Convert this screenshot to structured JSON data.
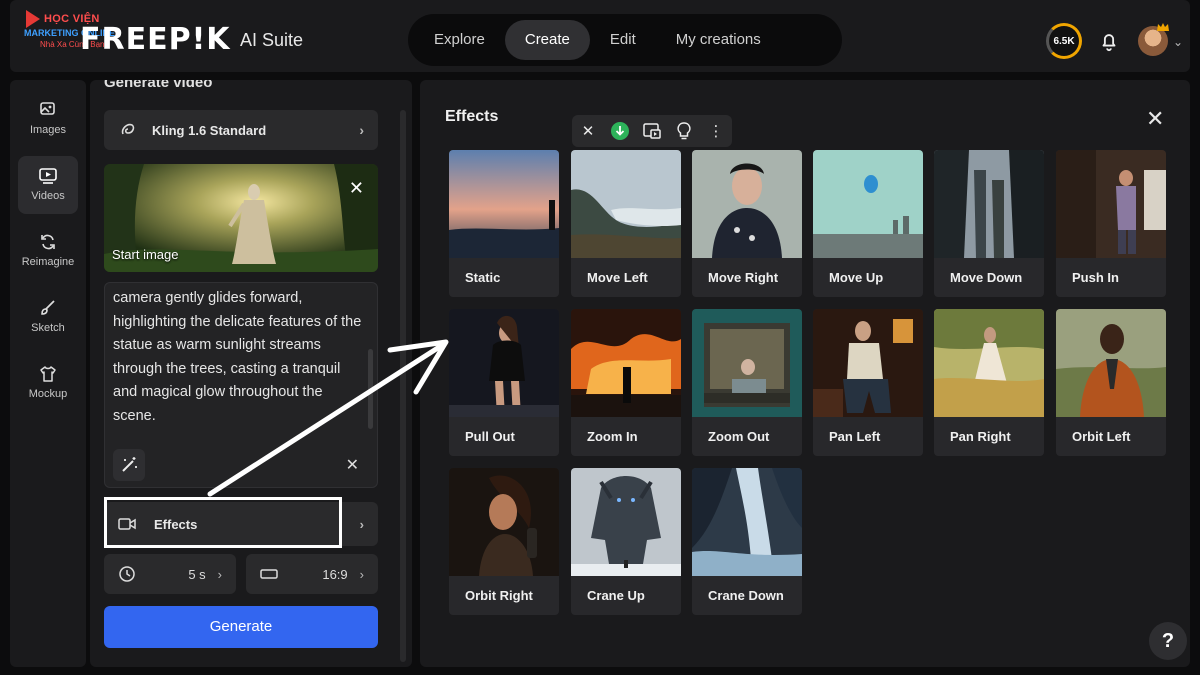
{
  "watermark": {
    "line1": "HỌC VIỆN",
    "line2": "MARKETING ONLINE",
    "line3": "Nhà Xa Cùng Bạn"
  },
  "header": {
    "logo": "FREEP!K",
    "suite": "AI Suite",
    "nav": [
      "Explore",
      "Create",
      "Edit",
      "My creations"
    ],
    "active_nav": "Create",
    "credits": "6.5K"
  },
  "rail": [
    {
      "label": "Images",
      "icon": "image-icon"
    },
    {
      "label": "Videos",
      "icon": "video-icon",
      "active": true
    },
    {
      "label": "Reimagine",
      "icon": "reimagine-icon"
    },
    {
      "label": "Sketch",
      "icon": "brush-icon"
    },
    {
      "label": "Mockup",
      "icon": "tshirt-icon"
    }
  ],
  "generate": {
    "title": "Generate video",
    "model": "Kling 1.6 Standard",
    "start_image_label": "Start image",
    "prompt": "camera gently glides forward, highlighting the delicate features of the statue as warm sunlight streams through the trees, casting a tranquil and magical glow throughout the scene.",
    "effects_label": "Effects",
    "duration": "5 s",
    "ratio": "16:9",
    "button": "Generate"
  },
  "effects": {
    "title": "Effects",
    "items": [
      {
        "name": "Static"
      },
      {
        "name": "Move Left"
      },
      {
        "name": "Move Right"
      },
      {
        "name": "Move Up"
      },
      {
        "name": "Move Down"
      },
      {
        "name": "Push In"
      },
      {
        "name": "Pull Out"
      },
      {
        "name": "Zoom In"
      },
      {
        "name": "Zoom Out"
      },
      {
        "name": "Pan Left"
      },
      {
        "name": "Pan Right"
      },
      {
        "name": "Orbit Left"
      },
      {
        "name": "Orbit Right"
      },
      {
        "name": "Crane Up"
      },
      {
        "name": "Crane Down"
      }
    ]
  },
  "help": "?",
  "colors": {
    "accent": "#3366f0",
    "panel": "#1a1a1c",
    "card": "#28282b",
    "download": "#2db35a"
  }
}
